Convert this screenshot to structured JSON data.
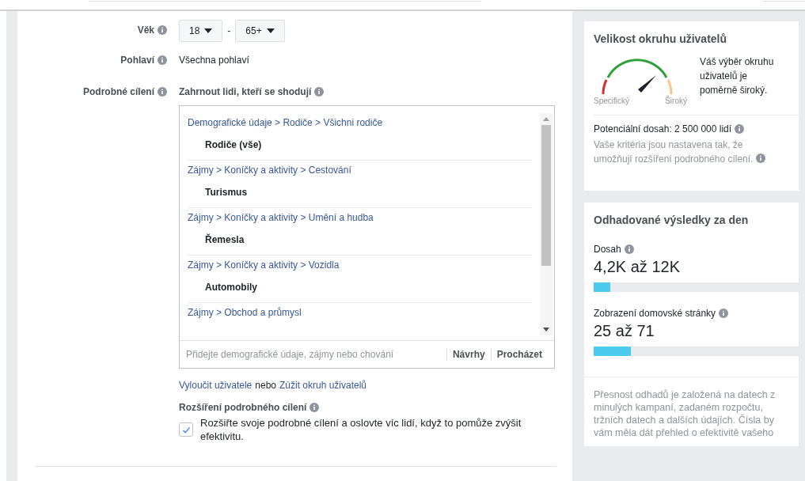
{
  "form": {
    "age": {
      "label": "Věk",
      "min": "18",
      "separator": "-",
      "max": "65+"
    },
    "gender": {
      "label": "Pohlaví",
      "value": "Všechna pohlaví"
    },
    "detailed_targeting": {
      "label": "Podrobné cílení",
      "include_label": "Zahrnout lidi, kteří se shodují",
      "items": [
        {
          "path": "Demografické údaje > Rodiče > Všichni rodiče",
          "name": "Rodiče (vše)"
        },
        {
          "path": "Zájmy > Koníčky a aktivity > Cestování",
          "name": "Turismus"
        },
        {
          "path": "Zájmy > Koníčky a aktivity > Umění a hudba",
          "name": "Řemesla"
        },
        {
          "path": "Zájmy > Koníčky a aktivity > Vozidla",
          "name": "Automobily"
        },
        {
          "path": "Zájmy > Obchod a průmysl"
        }
      ],
      "search": {
        "placeholder": "Přidejte demografické údaje, zájmy nebo chování"
      },
      "actions": [
        "Návrhy",
        "Procházet"
      ],
      "exclude_link": "Vyloučit uživatele",
      "or_text": "nebo",
      "narrow_link": "Zúžit okruh uživatelů"
    },
    "expansion": {
      "label": "Rozšíření podrobného cílení",
      "checked": true,
      "text": "Rozšiřte svoje podrobné cílení a oslovte víc lidí, když to pomůže zvýšit efektivitu."
    }
  },
  "audience_size": {
    "title": "Velikost okruhu uživatelů",
    "gauge_low": "Specifický",
    "gauge_high": "Široký",
    "summary": "Váš výběr okruhu uživatelů je poměrně široký.",
    "potential_reach": "Potenciální dosah: 2 500 000 lidí",
    "note": "Vaše kritéria jsou nastavena tak, že umožňují rozšíření podrobného cílení."
  },
  "daily_results": {
    "title": "Odhadované výsledky za den",
    "metrics": [
      {
        "label": "Dosah",
        "value": "4,2K až 12K",
        "level": 0.08
      },
      {
        "label": "Zobrazení domovské stránky",
        "value": "25 až 71",
        "level": 0.18
      }
    ],
    "disclaimer": "Přesnost odhadů je založená na datech z minulých kampaní, zadaném rozpočtu, tržních datech a dalších údajích. Čísla by vám měla dát přehled o efektivitě vašeho"
  }
}
